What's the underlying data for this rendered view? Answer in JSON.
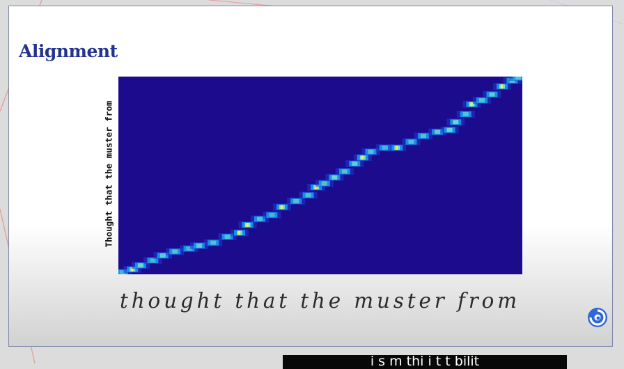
{
  "slide": {
    "title": "Alignment",
    "y_axis_text": "Thought that the muster from",
    "handwritten_text": "thought that the muster from"
  },
  "chart_data": {
    "type": "heatmap",
    "title": "",
    "ylabel": "Thought that the muster from",
    "xlabel": "thought that the muster from",
    "colors": {
      "background": "#1c0b8c",
      "low": "#1f3bd6",
      "mid": "#16a7ef",
      "high": "#8ff5c8",
      "peak": "#f0f04a"
    },
    "alignment_path": [
      {
        "x": 0.01,
        "y": 0.99,
        "w": 0.4
      },
      {
        "x": 0.035,
        "y": 0.975,
        "w": 0.8
      },
      {
        "x": 0.055,
        "y": 0.955,
        "w": 0.7
      },
      {
        "x": 0.085,
        "y": 0.93,
        "w": 0.4
      },
      {
        "x": 0.11,
        "y": 0.905,
        "w": 0.6
      },
      {
        "x": 0.14,
        "y": 0.885,
        "w": 0.5
      },
      {
        "x": 0.175,
        "y": 0.87,
        "w": 0.4
      },
      {
        "x": 0.2,
        "y": 0.855,
        "w": 0.6
      },
      {
        "x": 0.235,
        "y": 0.84,
        "w": 0.5
      },
      {
        "x": 0.27,
        "y": 0.81,
        "w": 0.5
      },
      {
        "x": 0.3,
        "y": 0.79,
        "w": 0.8
      },
      {
        "x": 0.32,
        "y": 0.75,
        "w": 0.9
      },
      {
        "x": 0.35,
        "y": 0.72,
        "w": 0.5
      },
      {
        "x": 0.38,
        "y": 0.7,
        "w": 0.4
      },
      {
        "x": 0.405,
        "y": 0.66,
        "w": 0.8
      },
      {
        "x": 0.44,
        "y": 0.63,
        "w": 0.5
      },
      {
        "x": 0.47,
        "y": 0.6,
        "w": 0.5
      },
      {
        "x": 0.49,
        "y": 0.56,
        "w": 0.9
      },
      {
        "x": 0.51,
        "y": 0.54,
        "w": 0.5
      },
      {
        "x": 0.535,
        "y": 0.51,
        "w": 0.7
      },
      {
        "x": 0.56,
        "y": 0.48,
        "w": 0.5
      },
      {
        "x": 0.585,
        "y": 0.44,
        "w": 0.6
      },
      {
        "x": 0.605,
        "y": 0.41,
        "w": 0.8
      },
      {
        "x": 0.625,
        "y": 0.38,
        "w": 0.5
      },
      {
        "x": 0.66,
        "y": 0.36,
        "w": 0.4
      },
      {
        "x": 0.69,
        "y": 0.36,
        "w": 0.8
      },
      {
        "x": 0.725,
        "y": 0.33,
        "w": 0.5
      },
      {
        "x": 0.755,
        "y": 0.3,
        "w": 0.5
      },
      {
        "x": 0.79,
        "y": 0.28,
        "w": 0.6
      },
      {
        "x": 0.82,
        "y": 0.27,
        "w": 0.7
      },
      {
        "x": 0.835,
        "y": 0.23,
        "w": 0.7
      },
      {
        "x": 0.86,
        "y": 0.19,
        "w": 0.5
      },
      {
        "x": 0.875,
        "y": 0.14,
        "w": 0.9
      },
      {
        "x": 0.9,
        "y": 0.12,
        "w": 0.5
      },
      {
        "x": 0.925,
        "y": 0.09,
        "w": 0.6
      },
      {
        "x": 0.95,
        "y": 0.05,
        "w": 0.8
      },
      {
        "x": 0.975,
        "y": 0.02,
        "w": 0.6
      },
      {
        "x": 0.99,
        "y": 0.005,
        "w": 0.5
      }
    ]
  },
  "logo": {
    "icon": "swirl-logo-icon",
    "color": "#2f66d8"
  },
  "caption": {
    "text": "i s m  thi i t   t bilit"
  }
}
